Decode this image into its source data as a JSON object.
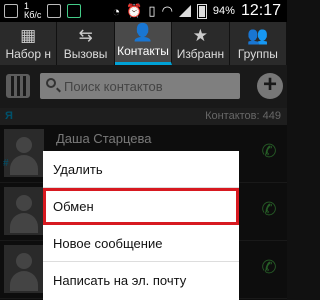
{
  "status_bar": {
    "left_text_1": "1",
    "left_text_2": "Кб/с",
    "battery": "94%",
    "time": "12:17",
    "icons": [
      "image-icon",
      "notification-icon",
      "sd-icon",
      "timer-icon",
      "alarm-icon",
      "vibrate-icon",
      "wifi-icon",
      "signal-icon",
      "battery-icon"
    ]
  },
  "tabs": [
    {
      "label": "Набор н",
      "icon": "keypad-icon"
    },
    {
      "label": "Вызовы",
      "icon": "calls-icon"
    },
    {
      "label": "Контакты",
      "icon": "contacts-icon"
    },
    {
      "label": "Избранн",
      "icon": "star-icon"
    },
    {
      "label": "Группы",
      "icon": "groups-icon"
    }
  ],
  "colors": {
    "accent": "#00a2d6",
    "highlight": "#d71920",
    "phone": "#4cba4c"
  },
  "search": {
    "placeholder": "Поиск контактов"
  },
  "section": {
    "letter": "Я",
    "count": "Контактов: 449"
  },
  "list": {
    "first_name": "Даша Старцева",
    "hash": "#"
  },
  "menu": {
    "items": [
      {
        "label": "Удалить"
      },
      {
        "label": "Обмен"
      },
      {
        "label": "Новое сообщение"
      },
      {
        "label": "Написать на эл. почту"
      }
    ]
  }
}
